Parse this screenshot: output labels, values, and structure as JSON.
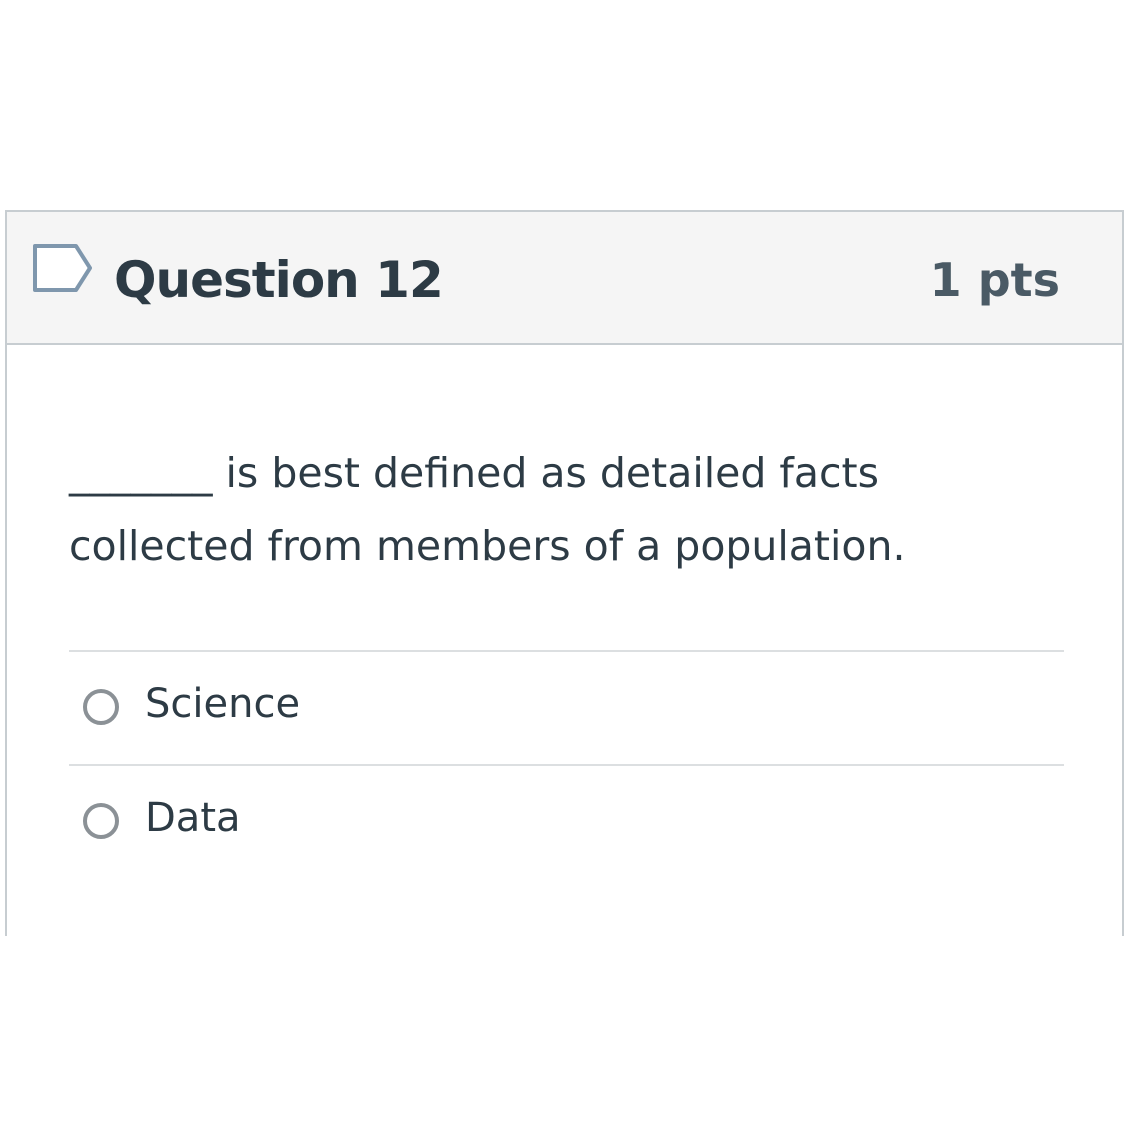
{
  "question": {
    "title": "Question 12",
    "points": "1 pts",
    "flag_icon": "flag-outline-icon",
    "text": "_______ is best defined as detailed facts collected from members of a population."
  },
  "answers": [
    {
      "label": "Science",
      "selected": false
    },
    {
      "label": "Data",
      "selected": false
    }
  ],
  "colors": {
    "header_background": "#f5f5f5",
    "border": "#c7cdd1",
    "text": "#2d3b45",
    "flag_stroke": "#7f97ad",
    "radio_stroke": "#8b9196"
  }
}
